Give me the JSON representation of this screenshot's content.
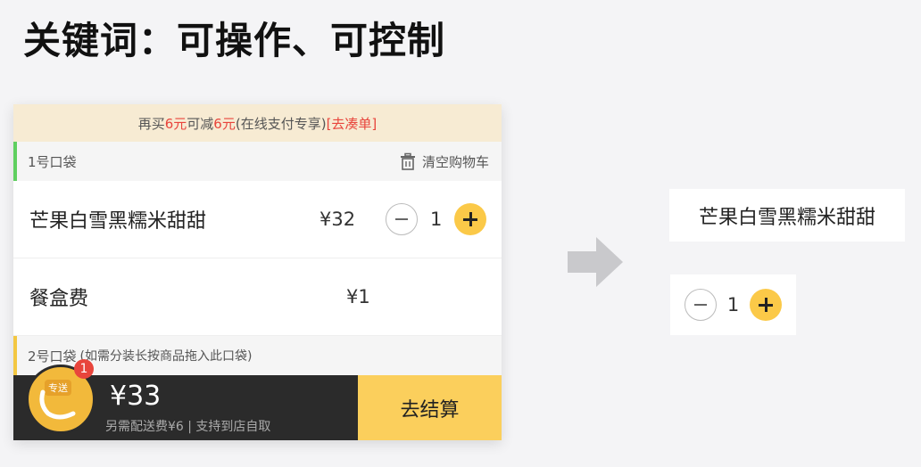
{
  "slide": {
    "title": "关键词：可操作、可控制"
  },
  "promo": {
    "prefix": "再买",
    "amount1": "6元",
    "mid": "可减",
    "amount2": "6元",
    "suffix": "(在线支付专享)",
    "link": "[去凑单]"
  },
  "bag1": {
    "label": "1号口袋",
    "clear_label": "清空购物车"
  },
  "items": [
    {
      "name": "芒果白雪黑糯米甜甜",
      "price": "¥32",
      "qty": "1"
    },
    {
      "name": "餐盒费",
      "price": "¥1"
    }
  ],
  "bag2": {
    "label": "2号口袋",
    "hint": "(如需分装长按商品拖入此口袋)"
  },
  "bottom": {
    "logo_tag": "专送",
    "badge_count": "1",
    "total": "¥33",
    "fee_note": "另需配送费¥6 | 支持到店自取",
    "checkout_label": "去结算"
  },
  "callouts": {
    "name": "芒果白雪黑糯米甜甜",
    "qty": "1"
  },
  "colors": {
    "accent_yellow": "#fbc948",
    "promo_red": "#e8453c",
    "bag1_bar": "#5fcf5f",
    "bag2_bar": "#f3c742"
  },
  "icons": [
    "trash-icon",
    "minus-icon",
    "plus-icon",
    "arrow-right-icon",
    "delivery-logo-icon"
  ]
}
